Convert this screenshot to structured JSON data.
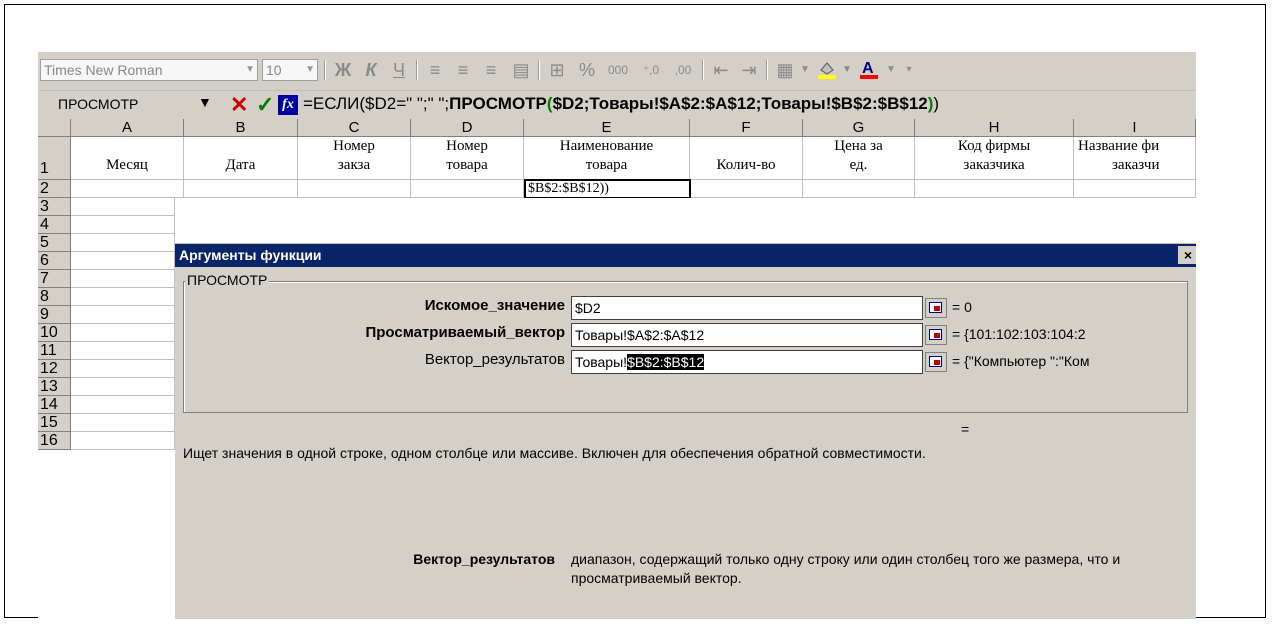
{
  "toolbar": {
    "font_name": "Times New Roman",
    "font_size": "10",
    "bold_glyph": "Ж",
    "italic_glyph": "К",
    "underline_glyph": "Ч",
    "percent_glyph": "%",
    "thousands_glyph": "000",
    "inc_decimal_glyph": "⁺,0",
    "dec_decimal_glyph": ",00",
    "icons": [
      "align-left-icon",
      "align-center-icon",
      "align-right-icon",
      "merge-cells-icon",
      "currency-icon",
      "indent-decrease-icon",
      "indent-increase-icon",
      "borders-icon",
      "fill-color-icon",
      "font-color-icon"
    ],
    "colors": {
      "fill_color": "#ffff00",
      "font_color": "#ff0000"
    }
  },
  "formula_bar": {
    "name_box": "ПРОСМОТР",
    "fx_label": "fx",
    "formula_part1": "=ЕСЛИ($D2=\" \";\" \";",
    "formula_bold1": "ПРОСМОТР",
    "formula_paren_open": "(",
    "formula_bold2": "$D2;Товары!$A$2:$A$12;Товары!$B$2:$B$12",
    "formula_paren_close": ")",
    "formula_end": ")"
  },
  "columns": [
    "A",
    "B",
    "C",
    "D",
    "E",
    "F",
    "G",
    "H",
    "I"
  ],
  "rows": [
    "1",
    "2",
    "3",
    "4",
    "5",
    "6",
    "7",
    "8",
    "9",
    "10",
    "11",
    "12",
    "13",
    "14",
    "15",
    "16"
  ],
  "header_row": {
    "a": "Месяц",
    "b": "Дата",
    "c1": "Номер",
    "c2": "закза",
    "d1": "Номер",
    "d2": "товара",
    "e1": "Наименование",
    "e2": "товара",
    "f": "Колич-во",
    "g1": "Цена за",
    "g2": "ед.",
    "h1": "Код фирмы",
    "h2": "заказчика",
    "i1": "Название фи",
    "i2": "заказчи"
  },
  "active_cell_text": "$B$2:$B$12))",
  "dialog": {
    "title": "Аргументы функции",
    "close": "×",
    "group_label": "ПРОСМОТР",
    "args": [
      {
        "label": "Искомое_значение",
        "value": "$D2",
        "result": "= 0"
      },
      {
        "label": "Просматриваемый_вектор",
        "value": "Товары!$A$2:$A$12",
        "result": "= {101:102:103:104:2"
      },
      {
        "label": "Вектор_результатов",
        "value_plain": "Товары!",
        "value_selected": "$B$2:$B$12",
        "result": "= {\"Компьютер \":\"Ком"
      }
    ],
    "formula_result": "=",
    "description": "Ищет значения в одной строке, одном столбце или массиве. Включен для обеспечения обратной совместимости.",
    "help_arg_name": "Вектор_результатов",
    "help_arg_text": "диапазон, содержащий только одну строку или один столбец того же размера, что и просматриваемый вектор."
  }
}
